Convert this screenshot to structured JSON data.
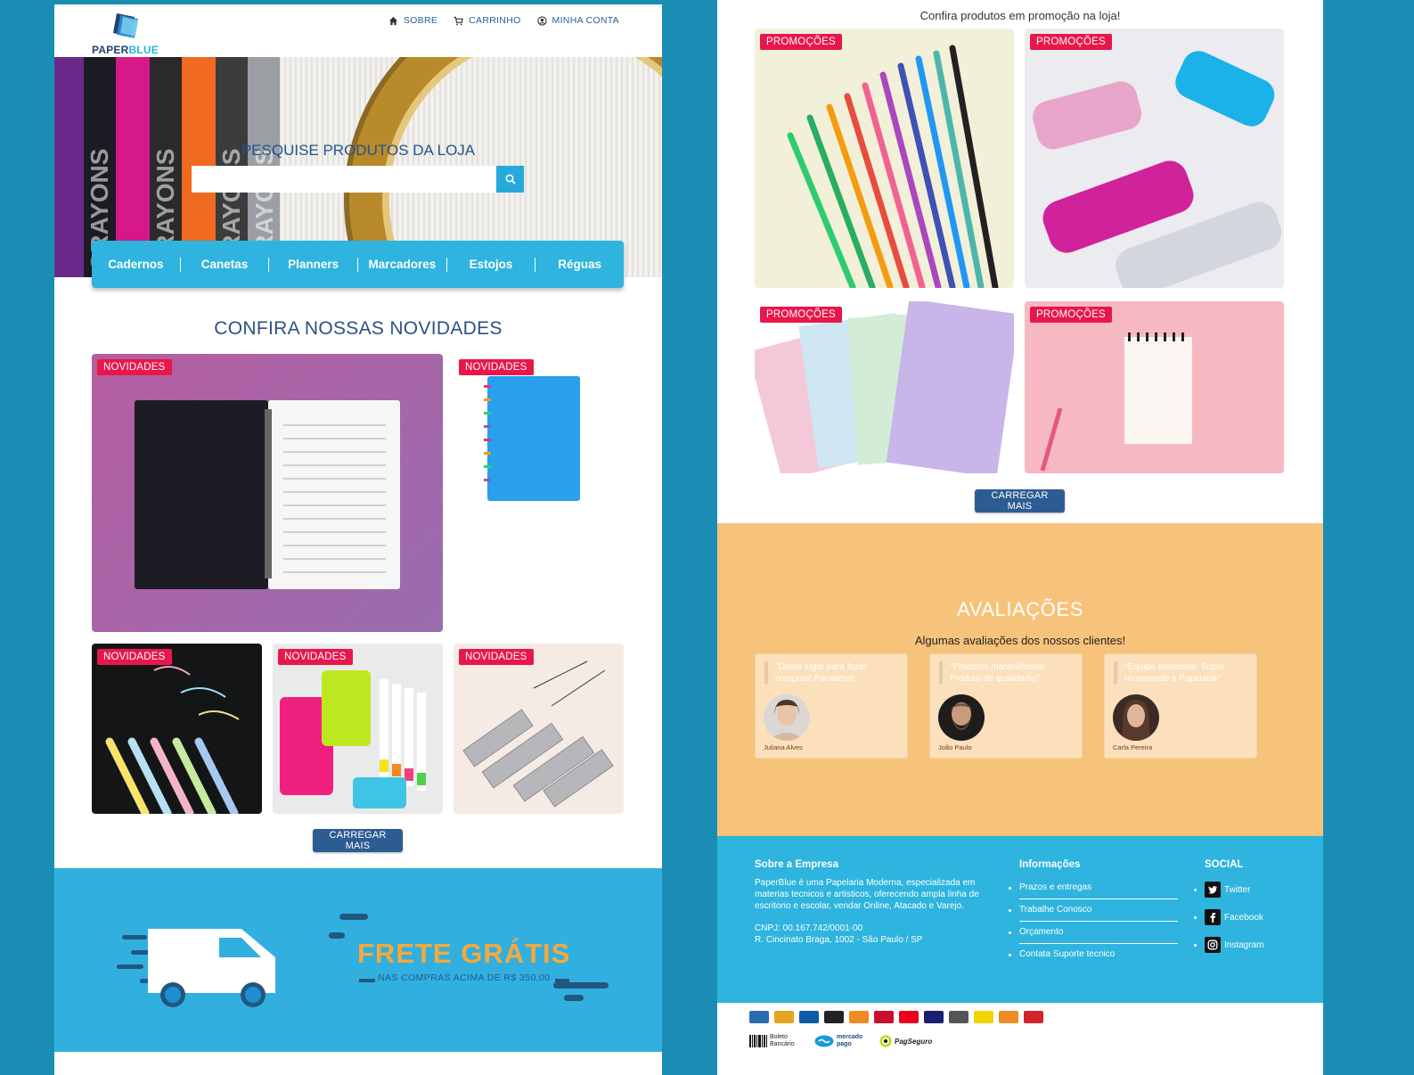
{
  "brand": {
    "name_part1": "PAPER",
    "name_part2": "BLUE"
  },
  "topnav": [
    {
      "label": "SOBRE",
      "icon": "home-icon"
    },
    {
      "label": "CARRINHO",
      "icon": "cart-icon"
    },
    {
      "label": "MINHA CONTA",
      "icon": "user-circle-icon"
    }
  ],
  "search": {
    "title": "PESQUISE PRODUTOS DA LOJA",
    "placeholder": "",
    "value": ""
  },
  "categories": [
    "Cadernos",
    "Canetas",
    "Planners",
    "Marcadores",
    "Estojos",
    "Réguas"
  ],
  "novidades": {
    "title": "CONFIRA NOSSAS NOVIDADES",
    "badge": "NOVIDADES",
    "load_more": "CARREGAR MAIS"
  },
  "frete": {
    "title": "FRETE GRÁTIS",
    "subtitle": "NAS COMPRAS ACIMA DE R$ 350,00"
  },
  "promo": {
    "title": "Confira produtos em promoção na loja!",
    "badge": "PROMOÇÕES",
    "load_more": "CARREGAR MAIS"
  },
  "reviews": {
    "title": "AVALIAÇÕES",
    "subtitle": "Algumas avaliações dos nossos clientes!",
    "items": [
      {
        "quote": "\"Ótimo lugar para fazer compras! Parabéns!",
        "name": "Juliana Alves"
      },
      {
        "quote": "\"Produtos maravilhosos! Produto de qualidade!\"",
        "name": "João Paulo"
      },
      {
        "quote": "\"Equipe atenciosa. Super recomendo a Papelaria!\"",
        "name": "Carla Pereira"
      }
    ]
  },
  "footer": {
    "about_title": "Sobre a Empresa",
    "about_text": "PaperBlue é uma Papelaria Moderna, especializada em materias tecnicos e artisticos, oferecendo ampla linha de escritorio e escolar, vendar Online, Atacado e Varejo.",
    "cnpj": "CNPJ: 00.167.742/0001-00",
    "address": "R. Cincinato Braga, 1002 - São Paulo / SP",
    "info_title": "Informações",
    "info_links": [
      "Prazos e entregas",
      "Trabalhe Conosco",
      "Orçamento",
      "Contata Suporte tecnico"
    ],
    "social_title": "SOCIAL",
    "social_links": [
      {
        "label": "Twitter",
        "icon": "twitter-icon"
      },
      {
        "label": "Facebook",
        "icon": "facebook-icon"
      },
      {
        "label": "Instagram",
        "icon": "instagram-icon"
      }
    ]
  },
  "payments": {
    "boleto": "Boleto Bancário",
    "mercado": "mercado pago",
    "pagseguro": "PagSeguro",
    "card_colors": [
      "#2b6bb1",
      "#e7a51d",
      "#0e5aa6",
      "#222222",
      "#f08a24",
      "#c8102e",
      "#eb001b",
      "#1a1f71",
      "#555555",
      "#f2d400",
      "#f08a24",
      "#d2232a"
    ]
  },
  "colors": {
    "accent": "#2eb4de",
    "badge": "#e8174b",
    "dark_blue": "#2d5c93",
    "reviews_bg": "#f7c37a"
  }
}
